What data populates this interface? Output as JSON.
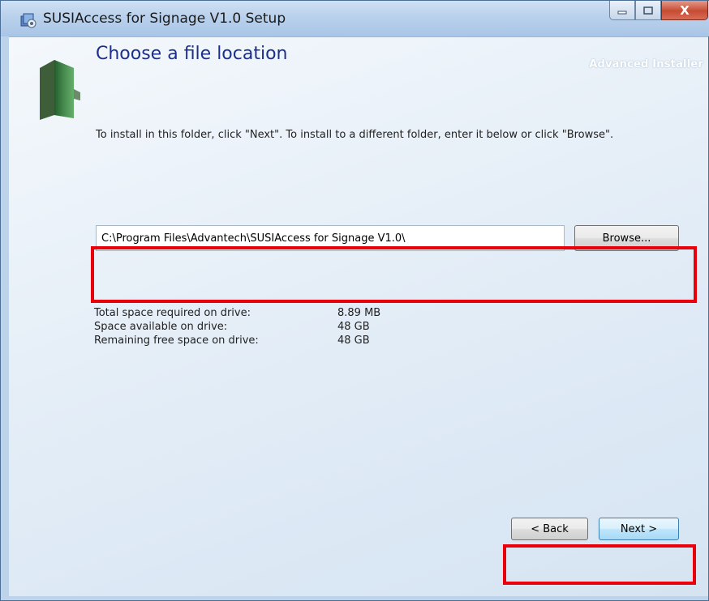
{
  "window": {
    "title": "SUSIAccess for Signage V1.0 Setup",
    "controls": {
      "close_label": "X"
    }
  },
  "installer": {
    "brand": "Advanced Installer",
    "heading": "Choose a file location",
    "description": "To install in this folder, click \"Next\". To install to a different folder, enter it below or click \"Browse\"."
  },
  "location": {
    "path_value": "C:\\Program Files\\Advantech\\SUSIAccess for Signage V1.0\\",
    "browse_label": "Browse..."
  },
  "space": {
    "rows": [
      {
        "label": "Total space required on drive:",
        "value": "8.89 MB"
      },
      {
        "label": "Space available on drive:",
        "value": "48 GB"
      },
      {
        "label": "Remaining free space on drive:",
        "value": "48 GB"
      }
    ]
  },
  "buttons": {
    "back_label": "< Back",
    "next_label": "Next >"
  },
  "colors": {
    "heading": "#1c2f8c",
    "highlight": "#e8000b",
    "titlebar": "#b9d1ec"
  }
}
